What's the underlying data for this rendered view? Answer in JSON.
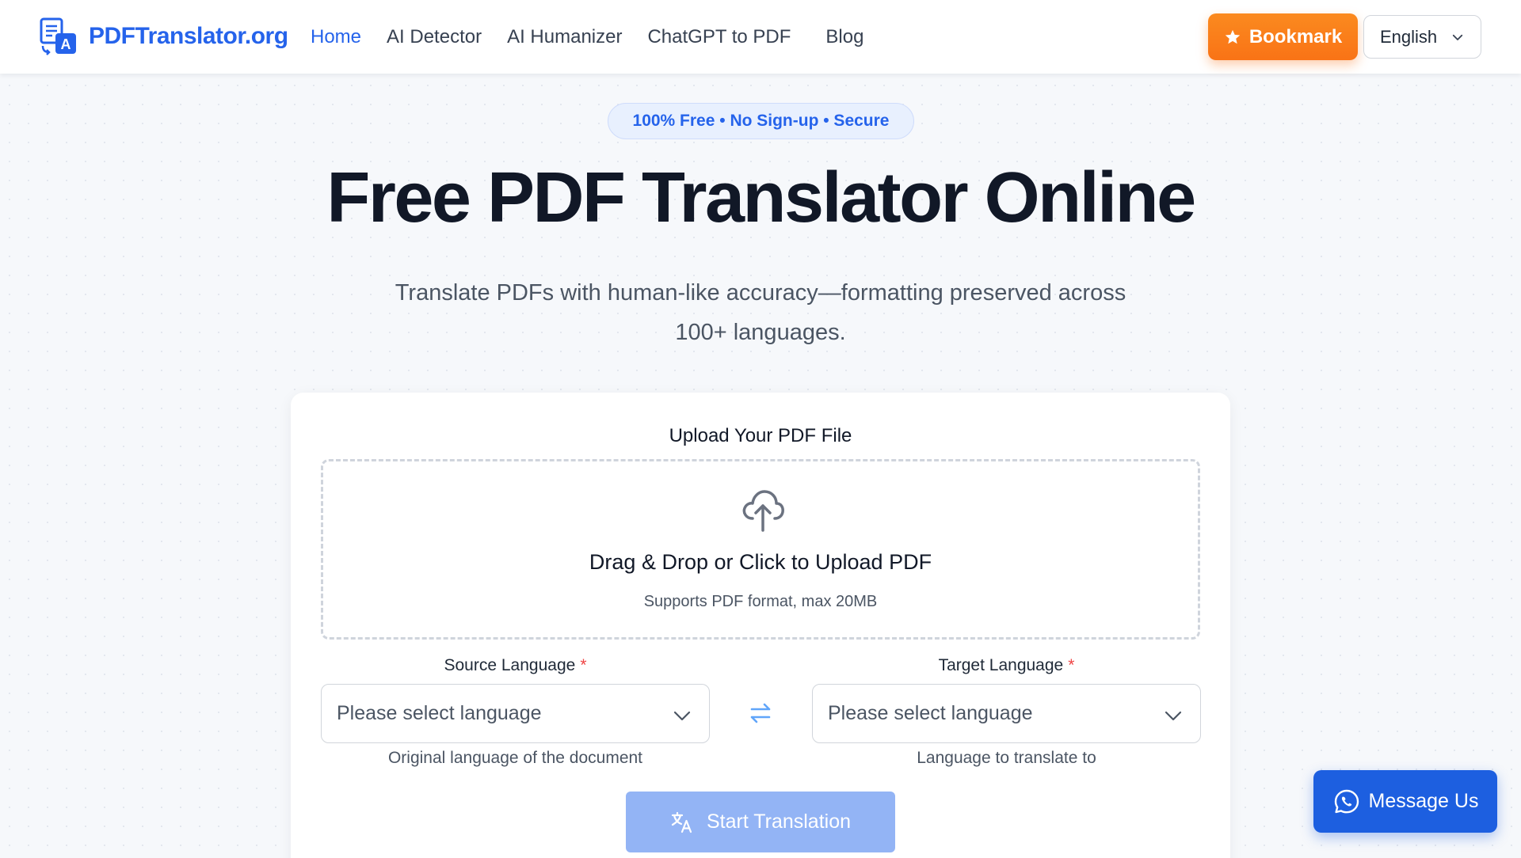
{
  "header": {
    "logo_text": "PDFTranslator.org",
    "nav": [
      {
        "label": "Home",
        "active": true
      },
      {
        "label": "AI Detector",
        "active": false
      },
      {
        "label": "AI Humanizer",
        "active": false
      },
      {
        "label": "ChatGPT to PDF",
        "active": false
      },
      {
        "label": "Blog",
        "active": false
      }
    ],
    "bookmark_label": "Bookmark",
    "language": "English"
  },
  "hero": {
    "badge": "100% Free • No Sign-up • Secure",
    "title": "Free PDF Translator Online",
    "subtitle_line1": "Translate PDFs with human-like accuracy—formatting preserved across",
    "subtitle_line2": "100+ languages."
  },
  "upload": {
    "label": "Upload Your PDF File",
    "drop_title": "Drag & Drop or Click to Upload PDF",
    "drop_sub": "Supports PDF format, max 20MB"
  },
  "source": {
    "label": "Source Language",
    "required_mark": "*",
    "placeholder": "Please select language",
    "helper": "Original language of the document"
  },
  "target": {
    "label": "Target Language",
    "required_mark": "*",
    "placeholder": "Please select language",
    "helper": "Language to translate to"
  },
  "actions": {
    "start_label": "Start Translation",
    "message_label": "Message Us"
  },
  "colors": {
    "brand": "#2563eb",
    "bookmark": "#f97316",
    "start_disabled": "#93b4f5",
    "message": "#1d5fe0",
    "required": "#ef4444"
  },
  "icons": {
    "logo": "translate-logo-icon",
    "bookmark": "star-icon",
    "language_chevron": "chevron-down-icon",
    "upload": "cloud-upload-icon",
    "swap": "swap-arrows-icon",
    "start": "translate-icon",
    "message": "whatsapp-icon"
  }
}
